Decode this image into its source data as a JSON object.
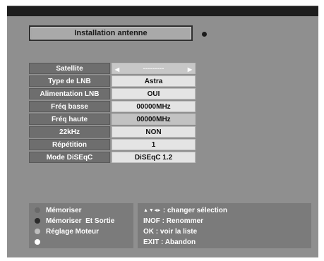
{
  "header": {
    "title": "Installation antenne"
  },
  "settings": {
    "rows": [
      {
        "label": "Satellite",
        "value": "---------"
      },
      {
        "label": "Type de LNB",
        "value": "Astra"
      },
      {
        "label": "Alimentation LNB",
        "value": "OUI"
      },
      {
        "label": "Fréq basse",
        "value": "00000MHz"
      },
      {
        "label": "Fréq haute",
        "value": "00000MHz"
      },
      {
        "label": "22kHz",
        "value": "NON"
      },
      {
        "label": "Répétition",
        "value": "1"
      },
      {
        "label": "Mode DiSEqC",
        "value": "DiSEqC 1.2"
      }
    ]
  },
  "legend": {
    "items": [
      {
        "label": "Mémoriser",
        "color": "#6a6a6a"
      },
      {
        "label": "Mémoriser  Et Sortie",
        "color": "#2b2b2b"
      },
      {
        "label": "Réglage Moteur",
        "color": "#bdbdbd"
      },
      {
        "label": "",
        "color": "#ffffff"
      }
    ]
  },
  "help": {
    "arrows": "▲▼◂▸",
    "lines": [
      ": changer sélection",
      "INOF : Renommer",
      "OK : voir la liste",
      "EXIT : Abandon"
    ]
  }
}
